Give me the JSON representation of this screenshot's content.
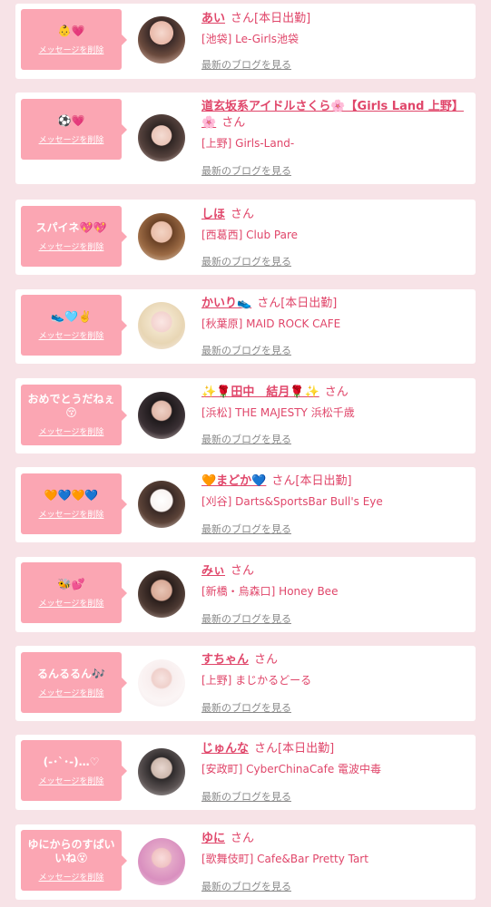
{
  "delete_label": "メッセージを削除",
  "san_suffix": "さん",
  "blog_label": "最新のブログを見る",
  "colors": {
    "accent": "#e0466a",
    "bubble": "#fba6b3",
    "background": "#f7e3e7"
  },
  "items": [
    {
      "message": "👶💗",
      "name": "あい",
      "status": "[本日出勤]",
      "shop": "[池袋] Le-Girls池袋",
      "avatar_icon": "avatar-photo"
    },
    {
      "message": "⚽💗",
      "name": "道玄坂系アイドルさくら🌸【Girls Land 上野】🌸",
      "status": "",
      "shop": "[上野] Girls-Land-",
      "avatar_icon": "avatar-photo"
    },
    {
      "message": "スパイネ💖💖",
      "name": "しほ",
      "status": "",
      "shop": "[西葛西] Club Pare",
      "avatar_icon": "avatar-photo"
    },
    {
      "message": "👟🩵✌️",
      "name": "かいり👟",
      "status": "[本日出勤]",
      "shop": "[秋葉原] MAID ROCK CAFE",
      "avatar_icon": "avatar-photo"
    },
    {
      "message": "おめでとうだねぇ😚",
      "name": "✨🌹田中　結月🌹✨",
      "status": "",
      "shop": "[浜松] THE MAJESTY 浜松千歳",
      "avatar_icon": "avatar-photo"
    },
    {
      "message": "🧡💙🧡💙",
      "name": "🧡まどか💙",
      "status": "[本日出勤]",
      "shop": "[刈谷] Darts&SportsBar Bull's Eye",
      "avatar_icon": "avatar-photo"
    },
    {
      "message": "🐝💕",
      "name": "みぃ",
      "status": "",
      "shop": "[新橋・烏森口] Honey Bee",
      "avatar_icon": "avatar-photo"
    },
    {
      "message": "るんるるん🎶",
      "name": "すちゃん",
      "status": "",
      "shop": "[上野] まじかるどーる",
      "avatar_icon": "avatar-photo"
    },
    {
      "message": "(-･`･-)…♡",
      "name": "じゅんな",
      "status": "[本日出勤]",
      "shop": "[安政町] CyberChinaCafe 電波中毒",
      "avatar_icon": "avatar-photo"
    },
    {
      "message": "ゆにからのすぱいいね😵",
      "name": "ゆに",
      "status": "",
      "shop": "[歌舞伎町] Cafe&Bar Pretty Tart",
      "avatar_icon": "avatar-photo"
    }
  ]
}
